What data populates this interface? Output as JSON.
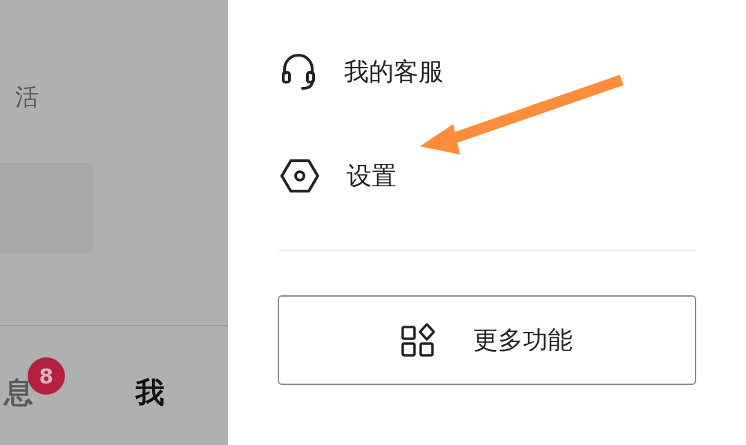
{
  "background_page": {
    "category_label": "活",
    "card": {
      "kind": "placeholder"
    },
    "bottom_nav": [
      {
        "label": "息",
        "selected": false,
        "badge": "8"
      },
      {
        "label": "我",
        "selected": true
      }
    ]
  },
  "drawer": {
    "items": [
      {
        "label": "我的客服",
        "kind": "headset"
      },
      {
        "label": "设置",
        "kind": "settings"
      }
    ],
    "more_button": {
      "label": "更多功能"
    }
  },
  "annotation": {
    "kind": "arrow"
  }
}
